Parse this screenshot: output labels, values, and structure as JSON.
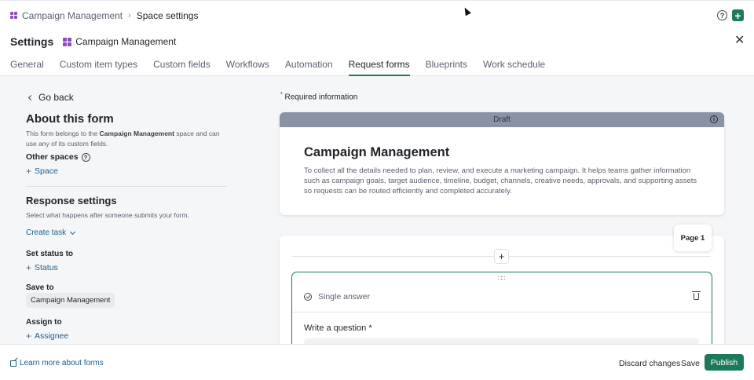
{
  "breadcrumb": {
    "space": "Campaign Management",
    "current": "Space settings"
  },
  "header": {
    "title": "Settings",
    "space_name": "Campaign Management"
  },
  "tabs": [
    {
      "label": "General"
    },
    {
      "label": "Custom item types"
    },
    {
      "label": "Custom fields"
    },
    {
      "label": "Workflows"
    },
    {
      "label": "Automation"
    },
    {
      "label": "Request forms",
      "active": true
    },
    {
      "label": "Blueprints"
    },
    {
      "label": "Work schedule"
    }
  ],
  "sidebar": {
    "go_back": "Go back",
    "about_title": "About this form",
    "about_desc_pre": "This form belongs to the ",
    "about_desc_space": "Campaign Management",
    "about_desc_post": " space and can use any of its custom fields.",
    "other_spaces_label": "Other spaces",
    "add_space": "Space",
    "response_title": "Response settings",
    "response_desc": "Select what happens after someone submits your form.",
    "create_task": "Create task",
    "set_status_label": "Set status to",
    "add_status": "Status",
    "save_to_label": "Save to",
    "save_to_value": "Campaign Management",
    "assign_to_label": "Assign to",
    "add_assignee": "Assignee"
  },
  "form": {
    "required_info": "Required information",
    "draft_label": "Draft",
    "title": "Campaign Management",
    "description": "To collect all the details needed to plan, review, and execute a marketing campaign. It helps teams gather information such as campaign goals, target audience, timeline, budget, channels, creative needs, approvals, and supporting assets so requests can be routed efficiently and completed accurately.",
    "page_label": "Page 1",
    "question_type": "Single answer",
    "question_label": "Write a question *"
  },
  "footer": {
    "learn_more": "Learn more about forms",
    "discard": "Discard changes",
    "save": "Save",
    "publish": "Publish"
  },
  "colors": {
    "accent": "#1b7a5a",
    "link": "#1b5f8a",
    "space_icon": "#8d4bc2",
    "draft_bar": "#8a93a6"
  },
  "icons": {
    "space": "space-grid-icon",
    "help": "help-circle-icon",
    "add": "plus-icon",
    "close": "close-icon",
    "info": "info-icon",
    "single_answer": "check-circle-icon",
    "delete": "trash-icon",
    "external": "external-link-icon"
  }
}
